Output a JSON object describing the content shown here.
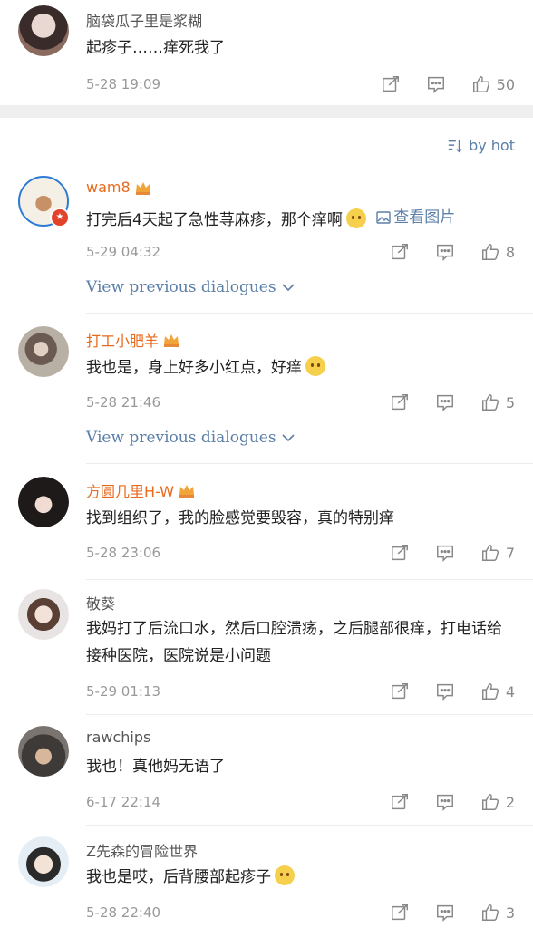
{
  "sort": {
    "label": "by hot"
  },
  "dialog_link_label": "View previous dialogues",
  "view_image_label": "查看图片",
  "comments": [
    {
      "name": "脑袋瓜子里是浆糊",
      "text": "起疹子……痒死我了",
      "time": "5-28 19:09",
      "likes": "50"
    },
    {
      "name": "wam8",
      "text": "打完后4天起了急性荨麻疹，那个痒啊",
      "time": "5-29 04:32",
      "likes": "8"
    },
    {
      "name": "打工小肥羊",
      "text": "我也是，身上好多小红点，好痒",
      "time": "5-28 21:46",
      "likes": "5"
    },
    {
      "name": "方圓几里H-W",
      "text": "找到组织了，我的脸感觉要毁容，真的特别痒",
      "time": "5-28 23:06",
      "likes": "7"
    },
    {
      "name": "敬葵",
      "text": "我妈打了后流口水，然后口腔溃疡，之后腿部很痒，打电话给接种医院，医院说是小问题",
      "time": "5-29 01:13",
      "likes": "4"
    },
    {
      "name": "rawchips",
      "text": "我也！真他妈无语了",
      "time": "6-17 22:14",
      "likes": "2"
    },
    {
      "name": "Z先森的冒险世界",
      "text": "我也是哎，后背腰部起疹子",
      "time": "5-28 22:40",
      "likes": "3"
    }
  ],
  "colors": {
    "accent": "#5b7fa8",
    "vip_name": "#e86a1e",
    "separator": "#efefef"
  }
}
